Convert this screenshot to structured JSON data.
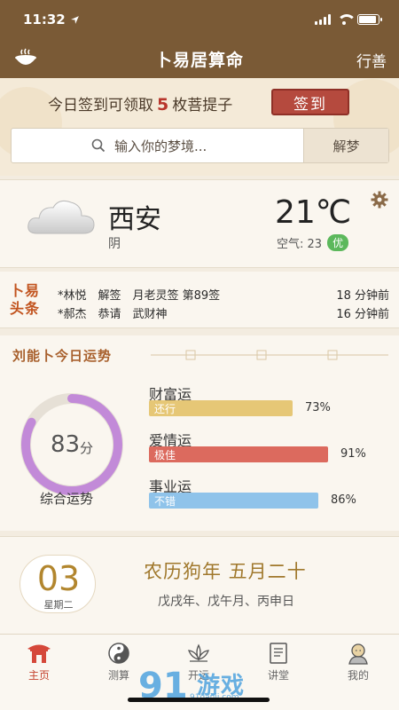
{
  "status": {
    "time": "11:32",
    "location_icon": "location-arrow-icon"
  },
  "header": {
    "title": "卜易居算命",
    "right_label": "行善",
    "left_icon": "incense-bowl-icon"
  },
  "signin": {
    "text_before": "今日签到可领取",
    "count": "5",
    "text_after": "枚菩提子",
    "button": "签到"
  },
  "search": {
    "placeholder": "输入你的梦境...",
    "button": "解梦",
    "icon": "search-icon"
  },
  "weather": {
    "city": "西安",
    "condition": "阴",
    "temp": "21℃",
    "air_label": "空气: 23",
    "aqi_badge": "优",
    "icon": "cloud-icon"
  },
  "news": {
    "logo_top": "卜易",
    "logo_bottom": "头条",
    "items": [
      {
        "text": "*林悦　解签　月老灵签 第89签",
        "time": "18 分钟前"
      },
      {
        "text": "*郝杰　恭请　武财神",
        "time": "16 分钟前"
      }
    ]
  },
  "fortune": {
    "header": "刘能卜今日运势",
    "score": "83",
    "score_unit": "分",
    "score_value": 83,
    "overall_label": "综合运势",
    "items": [
      {
        "title": "财富运",
        "level": "还行",
        "percent": "73%",
        "value": 73,
        "color": "#e6c776"
      },
      {
        "title": "爱情运",
        "level": "极佳",
        "percent": "91%",
        "value": 91,
        "color": "#dc6a5e"
      },
      {
        "title": "事业运",
        "level": "不错",
        "percent": "86%",
        "value": 86,
        "color": "#8fc3ea"
      }
    ]
  },
  "calendar": {
    "day": "03",
    "weekday": "星期二",
    "lunar": "农历狗年  五月二十",
    "ganzhi": "戊戌年、戊午月、丙申日"
  },
  "tabs": [
    {
      "label": "主页",
      "icon": "home-pavilion-icon",
      "active": true
    },
    {
      "label": "测算",
      "icon": "yin-yang-icon",
      "active": false
    },
    {
      "label": "开运",
      "icon": "lotus-icon",
      "active": false
    },
    {
      "label": "讲堂",
      "icon": "book-icon",
      "active": false
    },
    {
      "label": "我的",
      "icon": "monk-icon",
      "active": false
    }
  ],
  "watermark": {
    "text": "游戏",
    "sub": "91danji.com",
    "digits": "91"
  }
}
